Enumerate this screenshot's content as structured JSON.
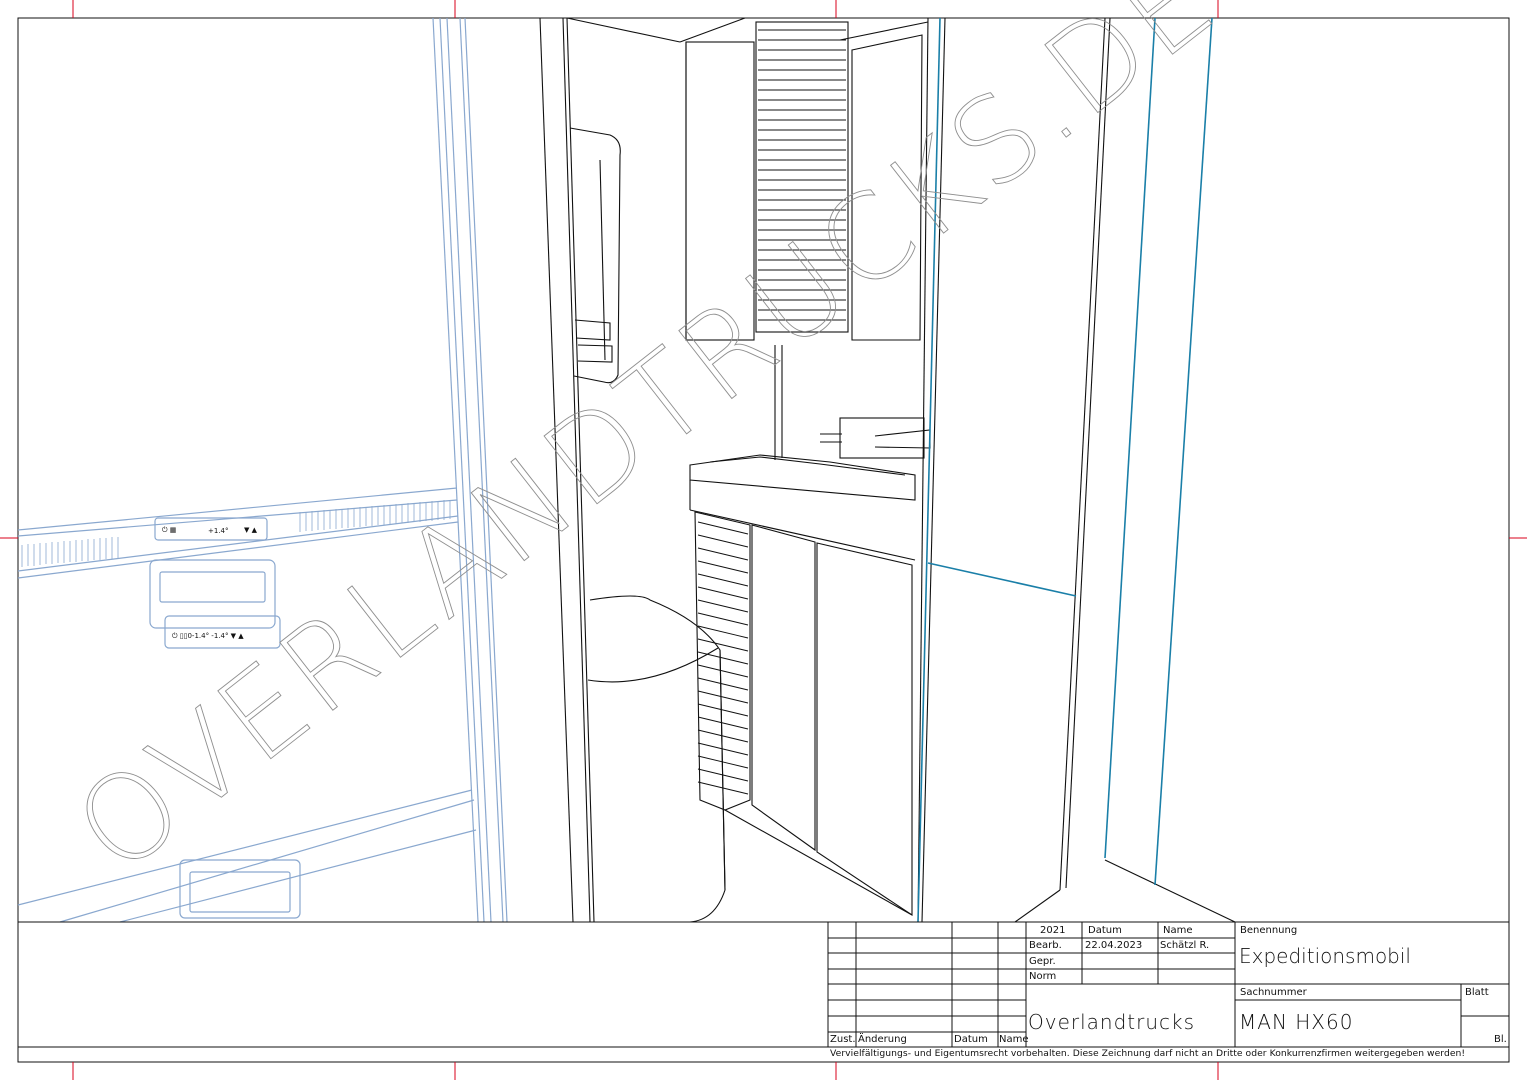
{
  "title_block": {
    "year": "2021",
    "col_datum": "Datum",
    "col_name": "Name",
    "row_bearb": "Bearb.",
    "row_gepr": "Gepr.",
    "row_norm": "Norm",
    "bearb_date": "22.04.2023",
    "bearb_name": "Schätzl R.",
    "benennung_label": "Benennung",
    "benennung_value": "Expeditionsmobil",
    "sachnummer_label": "Sachnummer",
    "sachnummer_value": "MAN HX60",
    "blatt_label": "Blatt",
    "bl_label": "Bl.",
    "company": "Overlandtrucks",
    "rev_zust": "Zust.",
    "rev_aenderung": "Änderung",
    "rev_datum": "Datum",
    "rev_name": "Name",
    "notice": "Vervielfältigungs- und Eigentumsrecht vorbehalten. Diese Zeichnung darf nicht an Dritte oder Konkurrenzfirmen weitergegeben werden!"
  },
  "watermark": "OVERLANDTRUCKS.DE",
  "colors": {
    "line": "#111111",
    "blue_lines": "#8aa8cf",
    "teal_lines": "#1a7fa8",
    "frame_marks": "#d9001b",
    "watermark": "#9a9a9a"
  }
}
